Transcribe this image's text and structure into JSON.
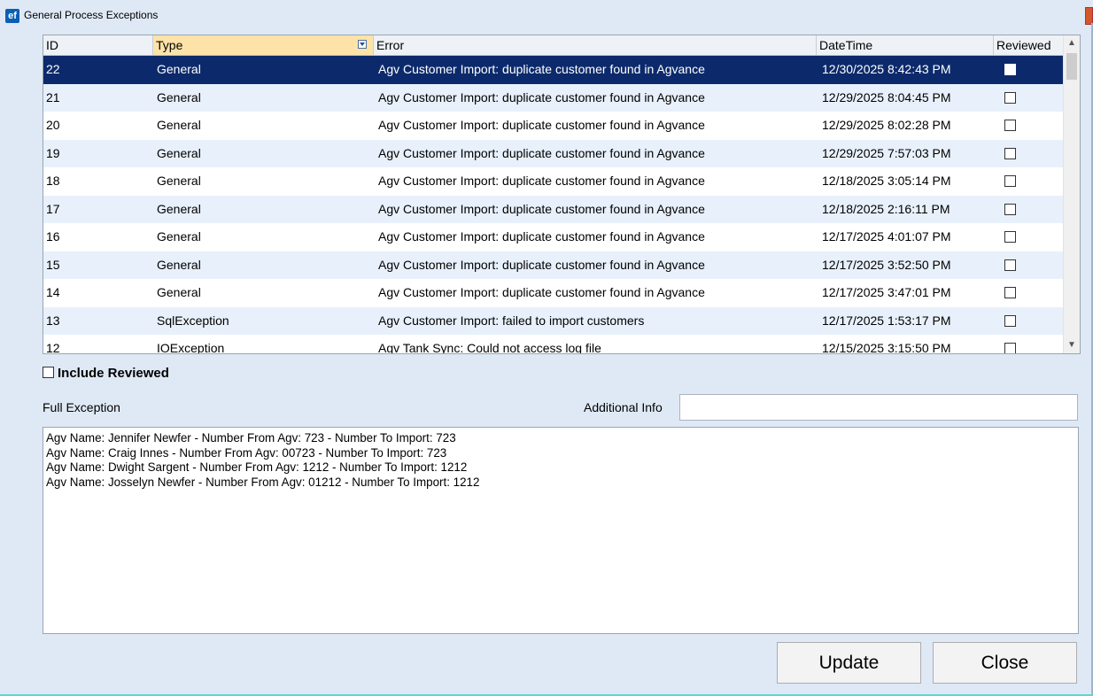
{
  "window": {
    "title": "General Process Exceptions",
    "icon": "ef-app-icon"
  },
  "grid": {
    "columns": [
      "ID",
      "Type",
      "Error",
      "DateTime",
      "Reviewed"
    ],
    "rows": [
      {
        "id": "22",
        "type": "General",
        "error": "Agv Customer Import: duplicate customer found in Agvance",
        "datetime": "12/30/2025 8:42:43 PM",
        "reviewed": false,
        "selected": true
      },
      {
        "id": "21",
        "type": "General",
        "error": "Agv Customer Import: duplicate customer found in Agvance",
        "datetime": "12/29/2025 8:04:45 PM",
        "reviewed": false
      },
      {
        "id": "20",
        "type": "General",
        "error": "Agv Customer Import: duplicate customer found in Agvance",
        "datetime": "12/29/2025 8:02:28 PM",
        "reviewed": false
      },
      {
        "id": "19",
        "type": "General",
        "error": "Agv Customer Import: duplicate customer found in Agvance",
        "datetime": "12/29/2025 7:57:03 PM",
        "reviewed": false
      },
      {
        "id": "18",
        "type": "General",
        "error": "Agv Customer Import: duplicate customer found in Agvance",
        "datetime": "12/18/2025 3:05:14 PM",
        "reviewed": false
      },
      {
        "id": "17",
        "type": "General",
        "error": "Agv Customer Import: duplicate customer found in Agvance",
        "datetime": "12/18/2025 2:16:11 PM",
        "reviewed": false
      },
      {
        "id": "16",
        "type": "General",
        "error": "Agv Customer Import: duplicate customer found in Agvance",
        "datetime": "12/17/2025 4:01:07 PM",
        "reviewed": false
      },
      {
        "id": "15",
        "type": "General",
        "error": "Agv Customer Import: duplicate customer found in Agvance",
        "datetime": "12/17/2025 3:52:50 PM",
        "reviewed": false
      },
      {
        "id": "14",
        "type": "General",
        "error": "Agv Customer Import: duplicate customer found in Agvance",
        "datetime": "12/17/2025 3:47:01 PM",
        "reviewed": false
      },
      {
        "id": "13",
        "type": "SqlException",
        "error": "Agv Customer Import: failed to import customers",
        "datetime": "12/17/2025 1:53:17 PM",
        "reviewed": false
      },
      {
        "id": "12",
        "type": "IOException",
        "error": "Agv Tank Sync: Could not access log file",
        "datetime": "12/15/2025 3:15:50 PM",
        "reviewed": false
      }
    ]
  },
  "include_reviewed": {
    "label": "Include Reviewed",
    "checked": false
  },
  "full_exception": {
    "label": "Full Exception",
    "lines": [
      "Agv Name: Jennifer Newfer - Number From Agv: 723 - Number To Import: 723",
      "Agv Name: Craig Innes - Number From Agv: 00723 - Number To Import: 723",
      "Agv Name: Dwight Sargent - Number From Agv: 1212 - Number To Import: 1212",
      "Agv Name: Josselyn Newfer - Number From Agv: 01212 - Number To Import: 1212"
    ]
  },
  "additional_info": {
    "label": "Additional Info",
    "value": ""
  },
  "buttons": {
    "update": "Update",
    "close": "Close"
  },
  "colors": {
    "selected_row": "#0c2a6b",
    "alt_row": "#e8f0fb",
    "sorted_header": "#fde3a8",
    "window_bg": "#dfe9f6"
  }
}
